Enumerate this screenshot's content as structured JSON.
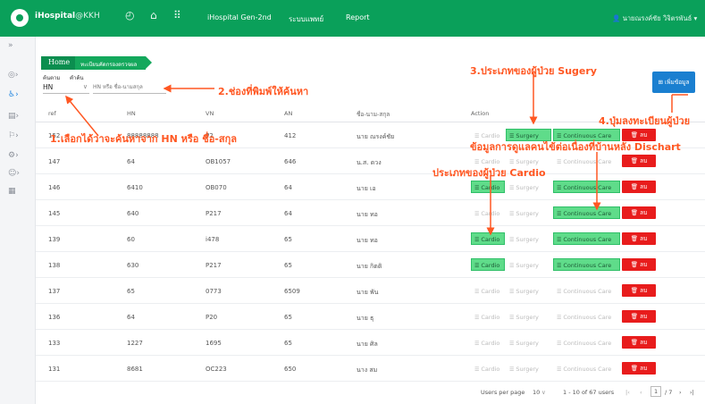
{
  "topbar": {
    "brand": "iHospital",
    "brand_suffix": "@KKH",
    "icons": [
      "gauge-icon",
      "home-icon",
      "apps-grid-icon"
    ],
    "nav": [
      "iHospital Gen-2nd",
      "ระบบแพทย์",
      "Report"
    ],
    "user": "👤 นายณรงค์ชัย วิจิตรพันธ์ ▾"
  },
  "sidebar": {
    "icons": [
      "collapse-icon",
      "dashboard-icon",
      "patient-icon",
      "records-icon",
      "flag-icon",
      "settings-icon",
      "person-icon",
      "document-icon"
    ]
  },
  "breadcrumb": {
    "home": "Home",
    "current": "ทะเบียนคัดกรองตรวจผล"
  },
  "filter": {
    "field_label": "ค้นตาม",
    "keyword_label": "คำค้น",
    "field_value": "HN",
    "search_placeholder": "HN หรือ ชื่อ-นามสกุล"
  },
  "add_button": "⊞ เพิ่มข้อมูล",
  "table": {
    "headers": [
      "ref",
      "HN",
      "VN",
      "AN",
      "ชื่อ-นาม-สกุล",
      "Action"
    ],
    "rows": [
      {
        "ref": "152",
        "hn": "88888888",
        "vn": "P2",
        "an": "412",
        "name": "นาย ณรงค์ชัย",
        "cardio": false,
        "surgery": true,
        "cc": true
      },
      {
        "ref": "147",
        "hn": "64",
        "vn": "OB1057",
        "an": "646",
        "name": "น.ส. ดวง",
        "cardio": false,
        "surgery": false,
        "cc": false
      },
      {
        "ref": "146",
        "hn": "6410",
        "vn": "OB070",
        "an": "64",
        "name": "นาย เอ",
        "cardio": true,
        "surgery": false,
        "cc": true
      },
      {
        "ref": "145",
        "hn": "640",
        "vn": "P217",
        "an": "64",
        "name": "นาย ทอ",
        "cardio": false,
        "surgery": false,
        "cc": true
      },
      {
        "ref": "139",
        "hn": "60",
        "vn": "i478",
        "an": "65",
        "name": "นาย ทอ",
        "cardio": true,
        "surgery": false,
        "cc": true
      },
      {
        "ref": "138",
        "hn": "630",
        "vn": "P217",
        "an": "65",
        "name": "นาย กิตติ",
        "cardio": true,
        "surgery": false,
        "cc": true
      },
      {
        "ref": "137",
        "hn": "65",
        "vn": "0773",
        "an": "6509",
        "name": "นาย พัน",
        "cardio": false,
        "surgery": false,
        "cc": false
      },
      {
        "ref": "136",
        "hn": "64",
        "vn": "P20",
        "an": "65",
        "name": "นาย ธุ",
        "cardio": false,
        "surgery": false,
        "cc": false
      },
      {
        "ref": "133",
        "hn": "1227",
        "vn": "1695",
        "an": "65",
        "name": "นาย ศิล",
        "cardio": false,
        "surgery": false,
        "cc": false
      },
      {
        "ref": "131",
        "hn": "8681",
        "vn": "OC223",
        "an": "650",
        "name": "นาง สม",
        "cardio": false,
        "surgery": false,
        "cc": false
      }
    ],
    "action_labels": {
      "cardio": "Cardio",
      "surgery": "Surgery",
      "cc": "Continuous Care",
      "delete": "🗑 ลบ"
    }
  },
  "footer": {
    "per_page_label": "Users per page",
    "per_page": "10",
    "range": "1 - 10 of 67 users",
    "page": "1",
    "total_pages": "/ 7"
  },
  "annotations": {
    "a1": "1.เลือกได้ว่าจะค้นหาจาก HN หรือ ชื่อ-สกุล",
    "a2": "2.ช่องที่พิมพ์ให้ค้นหา",
    "a3": "3.ประเภทของผู้ป่วย Sugery",
    "a4": "4.ปุ่มลงทะเบียนผู้ป่วย",
    "a5": "ข้อมูลการดูแลคนไข้ต่อเนื่องที่บ้านหลัง Dischart",
    "a6": "ประเภทของผู้ป่วย Cardio"
  },
  "colors": {
    "brand": "#0aa05a",
    "active": "#5fdc8a",
    "danger": "#e81c1c",
    "primary": "#1a7fd0",
    "annotation": "#ff5722"
  }
}
